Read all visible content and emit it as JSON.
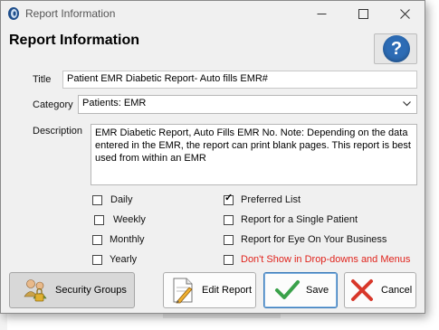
{
  "window": {
    "title": "Report Information",
    "heading": "Report Information",
    "controls": {
      "minimize": "—",
      "maximize": "☐",
      "close": "✕"
    }
  },
  "help": {
    "glyph": "?"
  },
  "form": {
    "title_label": "Title",
    "title_value": "Patient EMR Diabetic Report- Auto fills EMR#",
    "category_label": "Category",
    "category_value": "Patients: EMR",
    "description_label": "Description",
    "description_value": "EMR Diabetic Report, Auto Fills EMR No.  Note: Depending on the data entered in the EMR, the report can print blank pages.  This report is best used from within an EMR"
  },
  "options": {
    "daily": {
      "label": "Daily",
      "checked": false
    },
    "weekly": {
      "label": "Weekly",
      "checked": false
    },
    "monthly": {
      "label": "Monthly",
      "checked": false
    },
    "yearly": {
      "label": "Yearly",
      "checked": false
    },
    "preferred": {
      "label": "Preferred List",
      "checked": true
    },
    "single_patient": {
      "label": "Report for a Single Patient",
      "checked": false
    },
    "eye_on_business": {
      "label": "Report for Eye On Your Business",
      "checked": false
    },
    "dont_show": {
      "label": "Don't Show in Drop-downs and Menus",
      "checked": false
    }
  },
  "buttons": {
    "security_groups": "Security Groups",
    "edit_report": "Edit Report",
    "save": "Save",
    "cancel": "Cancel"
  },
  "colors": {
    "accent_blue": "#2d6cb5",
    "save_green": "#3aa14a",
    "cancel_red": "#d8372a",
    "warning_text": "#e0231c"
  }
}
